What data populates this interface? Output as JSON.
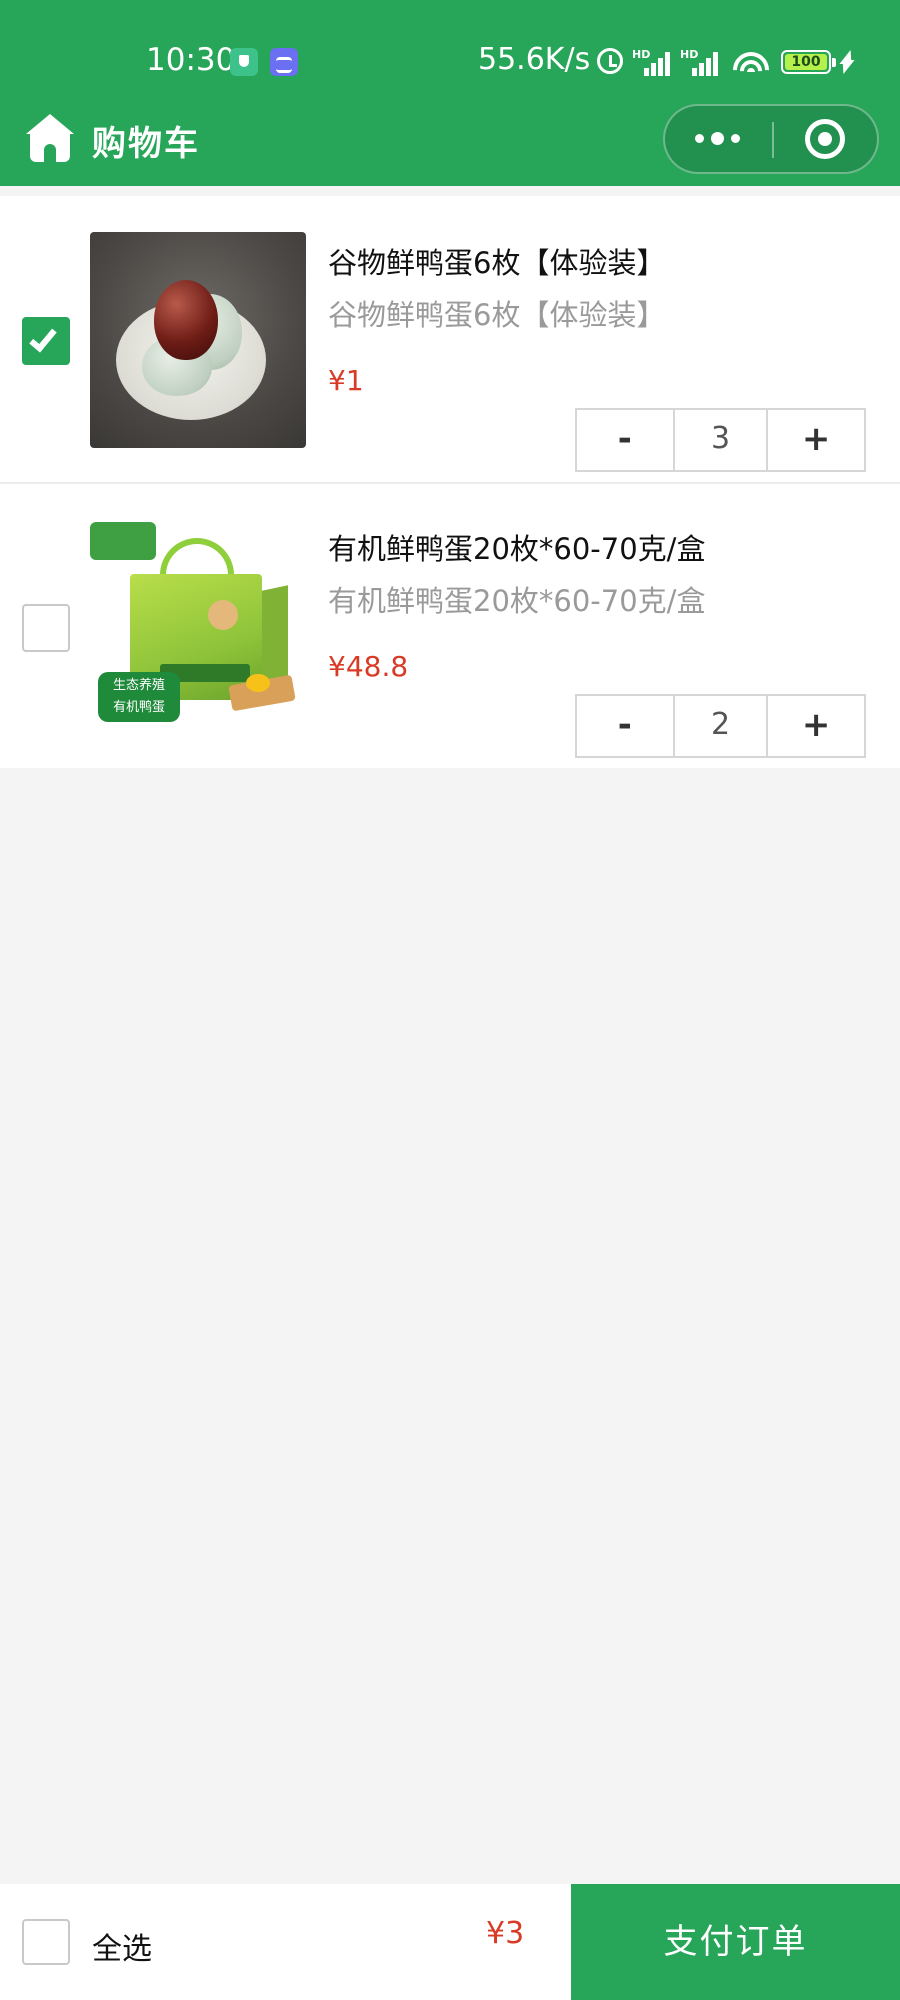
{
  "status_bar": {
    "time": "10:30",
    "network_speed": "55.6K/s",
    "signal_1_label": "HD",
    "signal_2_label": "HD",
    "battery_level": "100"
  },
  "nav": {
    "title": "购物车",
    "home_icon": "home-icon",
    "more_icon": "more-dots-icon",
    "close_icon": "miniprogram-close-icon"
  },
  "colors": {
    "brand_green": "#27a65a",
    "price_red": "#d93a26",
    "page_background": "#f4f4f4"
  },
  "cart": {
    "items": [
      {
        "name": "谷物鲜鸭蛋6枚【体验装】",
        "description": "谷物鲜鸭蛋6枚【体验装】",
        "price": "¥1",
        "quantity": "3",
        "checked": true,
        "minus_label": "-",
        "plus_label": "+"
      },
      {
        "name": "有机鲜鸭蛋20枚*60-70克/盒",
        "description": "有机鲜鸭蛋20枚*60-70克/盒",
        "price": "¥48.8",
        "quantity": "2",
        "checked": false,
        "minus_label": "-",
        "plus_label": "+",
        "image_badge_line1": "生态养殖",
        "image_badge_line2": "有机鸭蛋"
      }
    ]
  },
  "footer": {
    "select_all_label": "全选",
    "select_all_checked": false,
    "total_price": "¥3",
    "pay_button_label": "支付订单"
  }
}
